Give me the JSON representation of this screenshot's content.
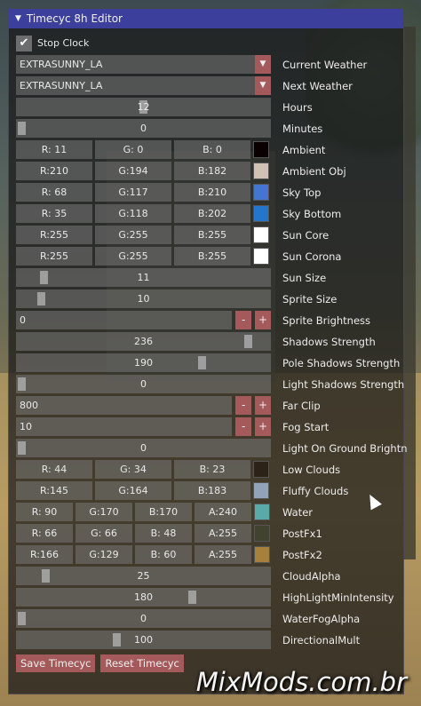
{
  "window": {
    "title": "Timecyc 8h Editor"
  },
  "stop_clock": {
    "label": "Stop Clock",
    "checked": true
  },
  "current_weather": {
    "value": "EXTRASUNNY_LA",
    "label": "Current Weather"
  },
  "next_weather": {
    "value": "EXTRASUNNY_LA",
    "label": "Next Weather"
  },
  "sliders": {
    "hours": {
      "label": "Hours",
      "value": "12",
      "fraction": 0.5
    },
    "minutes": {
      "label": "Minutes",
      "value": "0",
      "fraction": 0.0
    },
    "sun_size": {
      "label": "Sun Size",
      "value": "11",
      "fraction": 0.09
    },
    "sprite_size": {
      "label": "Sprite Size",
      "value": "10",
      "fraction": 0.08
    },
    "shadows_strength": {
      "label": "Shadows Strength",
      "value": "236",
      "fraction": 0.93
    },
    "pole_shadows": {
      "label": "Pole Shadows Strength",
      "value": "190",
      "fraction": 0.74
    },
    "light_shadows": {
      "label": "Light Shadows Strength",
      "value": "0",
      "fraction": 0.0
    },
    "light_on_ground": {
      "label": "Light On Ground Brightne",
      "value": "0",
      "fraction": 0.0
    },
    "cloud_alpha": {
      "label": "CloudAlpha",
      "value": "25",
      "fraction": 0.1
    },
    "highlight_min": {
      "label": "HighLightMinIntensity",
      "value": "180",
      "fraction": 0.7
    },
    "waterfog_alpha": {
      "label": "WaterFogAlpha",
      "value": "0",
      "fraction": 0.0
    },
    "directional_mult": {
      "label": "DirectionalMult",
      "value": "100",
      "fraction": 0.39
    }
  },
  "colors3": {
    "ambient": {
      "label": "Ambient",
      "r": "R: 11",
      "g": "G: 0",
      "b": "B: 0",
      "hex": "#0b0000"
    },
    "ambient_obj": {
      "label": "Ambient Obj",
      "r": "R:210",
      "g": "G:194",
      "b": "B:182",
      "hex": "#d2c2b6"
    },
    "sky_top": {
      "label": "Sky Top",
      "r": "R: 68",
      "g": "G:117",
      "b": "B:210",
      "hex": "#4475d2"
    },
    "sky_bottom": {
      "label": "Sky Bottom",
      "r": "R: 35",
      "g": "G:118",
      "b": "B:202",
      "hex": "#2376ca"
    },
    "sun_core": {
      "label": "Sun Core",
      "r": "R:255",
      "g": "G:255",
      "b": "B:255",
      "hex": "#ffffff"
    },
    "sun_corona": {
      "label": "Sun Corona",
      "r": "R:255",
      "g": "G:255",
      "b": "B:255",
      "hex": "#ffffff"
    },
    "low_clouds": {
      "label": "Low Clouds",
      "r": "R: 44",
      "g": "G: 34",
      "b": "B: 23",
      "hex": "#2c2217"
    },
    "fluffy_clouds": {
      "label": "Fluffy Clouds",
      "r": "R:145",
      "g": "G:164",
      "b": "B:183",
      "hex": "#91a4b7"
    }
  },
  "colors4": {
    "water": {
      "label": "Water",
      "r": "R: 90",
      "g": "G:170",
      "b": "B:170",
      "a": "A:240",
      "hex": "#5aaaaa"
    },
    "postfx1": {
      "label": "PostFx1",
      "r": "R: 66",
      "g": "G: 66",
      "b": "B: 48",
      "a": "A:255",
      "hex": "#424230"
    },
    "postfx2": {
      "label": "PostFx2",
      "r": "R:166",
      "g": "G:129",
      "b": "B: 60",
      "a": "A:255",
      "hex": "#a6813c"
    }
  },
  "inputs": {
    "sprite_brightness": {
      "label": "Sprite Brightness",
      "value": "0"
    },
    "far_clip": {
      "label": "Far Clip",
      "value": "800"
    },
    "fog_start": {
      "label": "Fog Start",
      "value": "10"
    }
  },
  "buttons": {
    "minus": "-",
    "plus": "+",
    "save": "Save Timecyc",
    "reset": "Reset Timecyc",
    "dropdown_arrow": "▼"
  },
  "watermark": "MixMods.com.br",
  "icons": {
    "collapse": "triangle-down-icon",
    "check": "checkmark-icon"
  }
}
